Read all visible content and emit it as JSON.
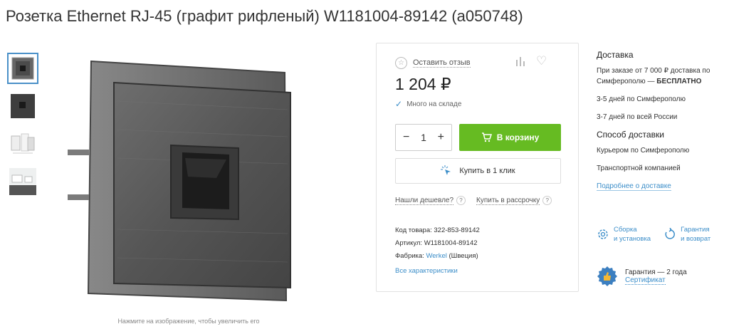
{
  "product": {
    "title": "Розетка Ethernet RJ-45 (графит рифленый) W1181004-89142 (a050748)",
    "image_hint": "Нажмите на изображение, чтобы увеличить его",
    "thumbnails": [
      "socket-front",
      "socket-dark",
      "socket-exploded",
      "socket-interior"
    ]
  },
  "buybox": {
    "review_label": "Оставить отзыв",
    "price": "1 204 ₽",
    "stock": "Много на складе",
    "qty_minus": "−",
    "quantity": "1",
    "qty_plus": "+",
    "cart_label": "В корзину",
    "oneclick_label": "Купить в 1 клик",
    "cheaper_label": "Нашли дешевле?",
    "installment_label": "Купить в рассрочку",
    "qmark": "?",
    "specs": {
      "code_label": "Код товара:",
      "code": "322-853-89142",
      "article_label": "Артикул:",
      "article": "W1181004-89142",
      "factory_label": "Фабрика:",
      "factory": "Werkel",
      "country": "(Швеция)"
    },
    "all_specs": "Все характеристики",
    "accent_green": "#66bb22",
    "link_blue": "#3c8ec9"
  },
  "delivery": {
    "heading": "Доставка",
    "free_text": "При заказе от 7 000 ₽ доставка по Симферополю —",
    "free_bold": "БЕСПЛАТНО",
    "city_days": "3-5 дней по Симферополю",
    "russia_days": "3-7 дней по всей России",
    "method_heading": "Способ доставки",
    "courier": "Курьером по Симферополю",
    "transport": "Транспортной компанией",
    "more_link": "Подробнее о доставке"
  },
  "services": {
    "assembly_line1": "Сборка",
    "assembly_line2": "и установка",
    "return_line1": "Гарантия",
    "return_line2": "и возврат"
  },
  "warranty": {
    "text": "Гарантия — 2 года",
    "certificate": "Сертификат"
  }
}
